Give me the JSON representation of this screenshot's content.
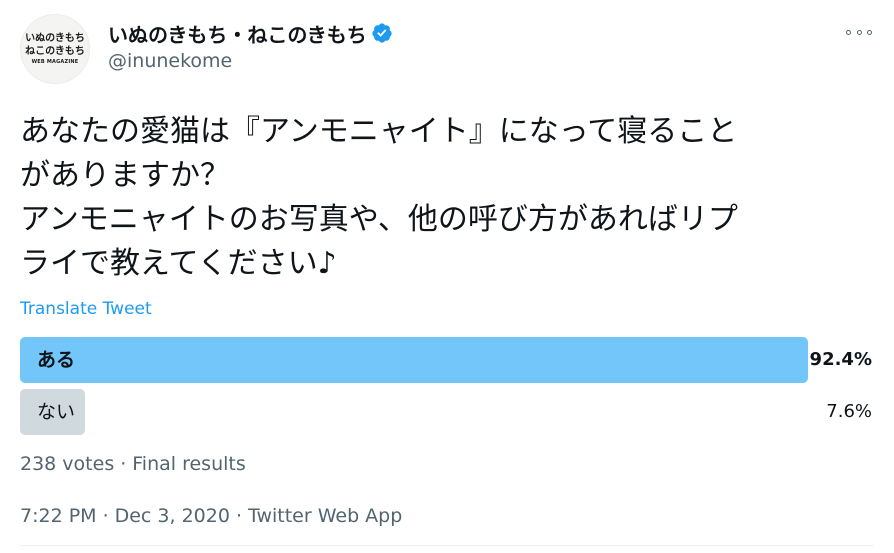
{
  "account": {
    "avatar_lines": [
      "いぬのきもち",
      "ねこのきもち"
    ],
    "avatar_sub": "WEB MAGAZINE",
    "display_name": "いぬのきもち・ねこのきもち",
    "handle": "@inunekome",
    "verified_icon": "verified-badge-icon",
    "more_icon": "more-options-icon"
  },
  "tweet": {
    "text_lines": [
      "あなたの愛猫は『アンモニャイト』になって寝ること",
      "がありますか？",
      "アンモニャイトのお写真や、他の呼び方があればリプ",
      "ライで教えてください♪"
    ],
    "translate_label": "Translate Tweet"
  },
  "poll": {
    "options": [
      {
        "label": "ある",
        "percent_label": "92.4%",
        "percent": 92.4,
        "winner": true
      },
      {
        "label": "ない",
        "percent_label": "7.6%",
        "percent": 7.6,
        "winner": false
      }
    ],
    "votes": "238 votes",
    "status": "Final results"
  },
  "timestamp": {
    "time": "7:22 PM",
    "date": "Dec 3, 2020",
    "source": "Twitter Web App"
  },
  "colors": {
    "winner_bar": "#72c6fa",
    "loser_bar": "#cfd9de",
    "accent": "#1d9bf0",
    "secondary_text": "#536471"
  }
}
